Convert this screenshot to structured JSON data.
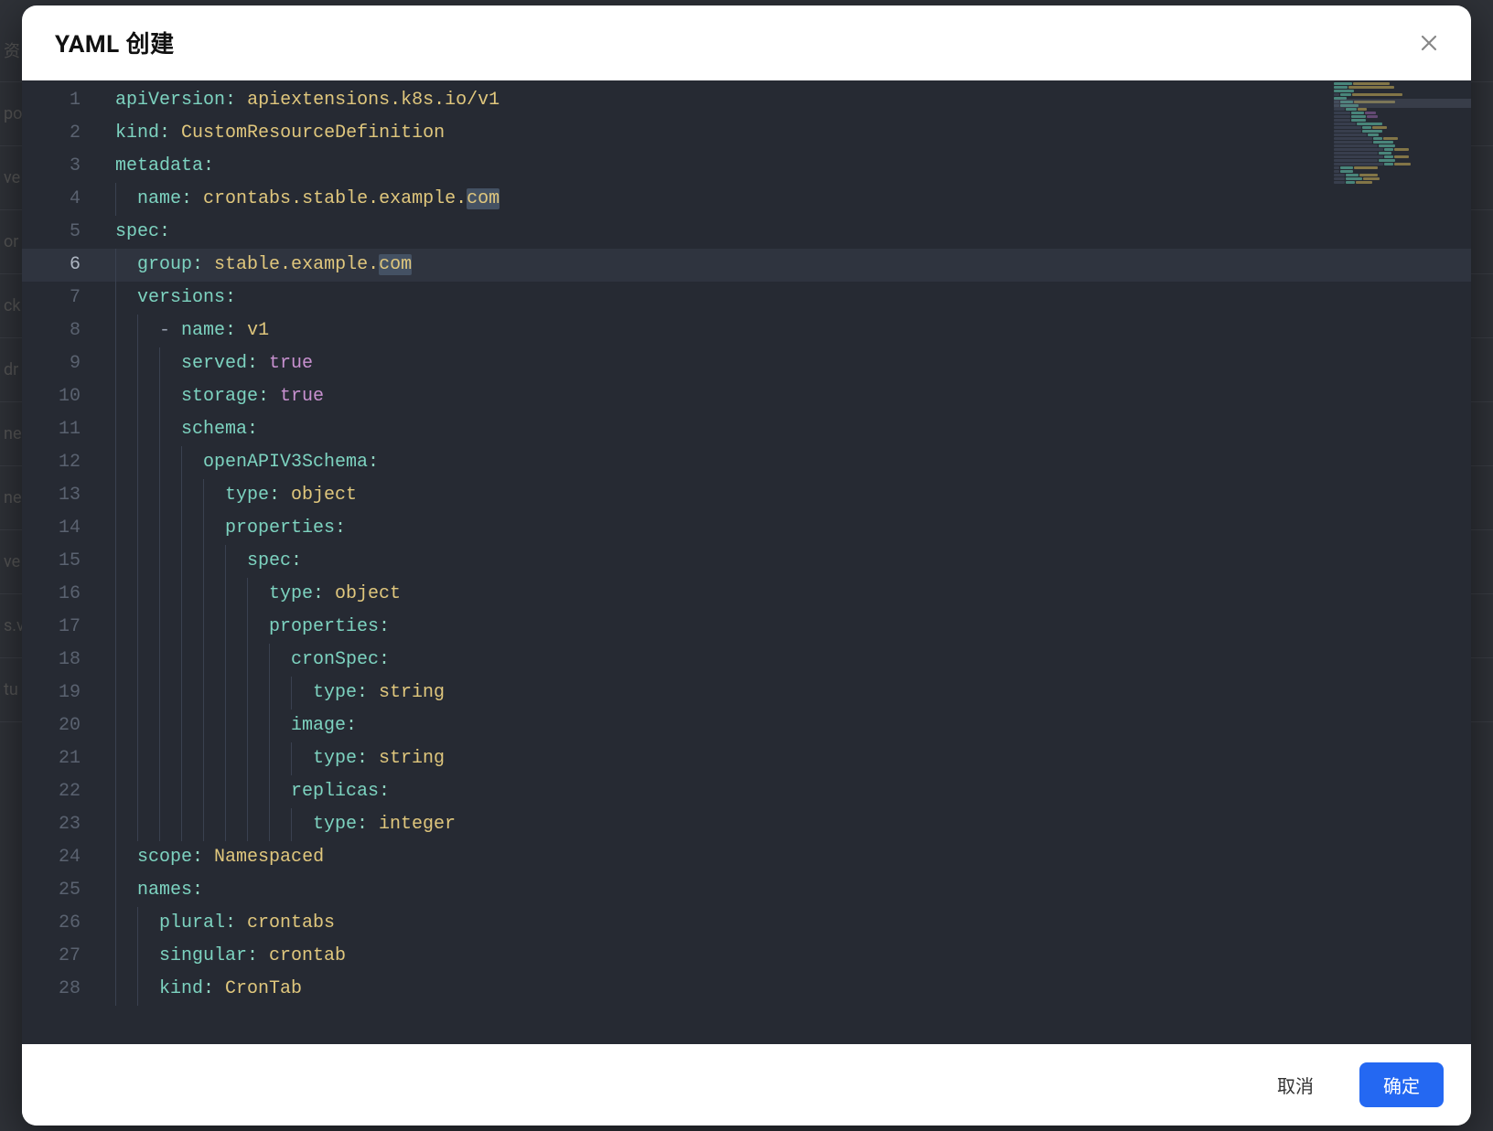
{
  "modal": {
    "title": "YAML 创建",
    "cancel_label": "取消",
    "confirm_label": "确定"
  },
  "background_items": [
    "资",
    "po",
    "ve",
    "or",
    "ck",
    "dr",
    "ne",
    "ne",
    "ve",
    "s.v",
    "tu"
  ],
  "editor": {
    "active_line": 6,
    "lines": [
      {
        "n": 1,
        "indent": 0,
        "guides": [],
        "tokens": [
          [
            "key",
            "apiVersion"
          ],
          [
            "punc",
            ":"
          ],
          [
            "plain",
            " "
          ],
          [
            "str",
            "apiextensions.k8s.io/v1"
          ]
        ]
      },
      {
        "n": 2,
        "indent": 0,
        "guides": [],
        "tokens": [
          [
            "key",
            "kind"
          ],
          [
            "punc",
            ":"
          ],
          [
            "plain",
            " "
          ],
          [
            "str",
            "CustomResourceDefinition"
          ]
        ]
      },
      {
        "n": 3,
        "indent": 0,
        "guides": [],
        "tokens": [
          [
            "key",
            "metadata"
          ],
          [
            "punc",
            ":"
          ]
        ]
      },
      {
        "n": 4,
        "indent": 1,
        "guides": [
          0
        ],
        "tokens": [
          [
            "key",
            "name"
          ],
          [
            "punc",
            ":"
          ],
          [
            "plain",
            " "
          ],
          [
            "str",
            "crontabs.stable.example."
          ],
          [
            "str-hl",
            "com"
          ]
        ]
      },
      {
        "n": 5,
        "indent": 0,
        "guides": [],
        "tokens": [
          [
            "key",
            "spec"
          ],
          [
            "punc",
            ":"
          ]
        ]
      },
      {
        "n": 6,
        "indent": 1,
        "guides": [
          0
        ],
        "tokens": [
          [
            "key",
            "group"
          ],
          [
            "punc",
            ":"
          ],
          [
            "plain",
            " "
          ],
          [
            "str",
            "stable.example."
          ],
          [
            "str-hl",
            "com"
          ]
        ]
      },
      {
        "n": 7,
        "indent": 1,
        "guides": [
          0
        ],
        "tokens": [
          [
            "key",
            "versions"
          ],
          [
            "punc",
            ":"
          ]
        ]
      },
      {
        "n": 8,
        "indent": 2,
        "guides": [
          0,
          1
        ],
        "tokens": [
          [
            "dash",
            "- "
          ],
          [
            "key",
            "name"
          ],
          [
            "punc",
            ":"
          ],
          [
            "plain",
            " "
          ],
          [
            "str",
            "v1"
          ]
        ]
      },
      {
        "n": 9,
        "indent": 3,
        "guides": [
          0,
          1,
          2
        ],
        "tokens": [
          [
            "key",
            "served"
          ],
          [
            "punc",
            ":"
          ],
          [
            "plain",
            " "
          ],
          [
            "bool",
            "true"
          ]
        ]
      },
      {
        "n": 10,
        "indent": 3,
        "guides": [
          0,
          1,
          2
        ],
        "tokens": [
          [
            "key",
            "storage"
          ],
          [
            "punc",
            ":"
          ],
          [
            "plain",
            " "
          ],
          [
            "bool",
            "true"
          ]
        ]
      },
      {
        "n": 11,
        "indent": 3,
        "guides": [
          0,
          1,
          2
        ],
        "tokens": [
          [
            "key",
            "schema"
          ],
          [
            "punc",
            ":"
          ]
        ]
      },
      {
        "n": 12,
        "indent": 4,
        "guides": [
          0,
          1,
          2,
          3
        ],
        "tokens": [
          [
            "key",
            "openAPIV3Schema"
          ],
          [
            "punc",
            ":"
          ]
        ]
      },
      {
        "n": 13,
        "indent": 5,
        "guides": [
          0,
          1,
          2,
          3,
          4
        ],
        "tokens": [
          [
            "key",
            "type"
          ],
          [
            "punc",
            ":"
          ],
          [
            "plain",
            " "
          ],
          [
            "str",
            "object"
          ]
        ]
      },
      {
        "n": 14,
        "indent": 5,
        "guides": [
          0,
          1,
          2,
          3,
          4
        ],
        "tokens": [
          [
            "key",
            "properties"
          ],
          [
            "punc",
            ":"
          ]
        ]
      },
      {
        "n": 15,
        "indent": 6,
        "guides": [
          0,
          1,
          2,
          3,
          4,
          5
        ],
        "tokens": [
          [
            "key",
            "spec"
          ],
          [
            "punc",
            ":"
          ]
        ]
      },
      {
        "n": 16,
        "indent": 7,
        "guides": [
          0,
          1,
          2,
          3,
          4,
          5,
          6
        ],
        "tokens": [
          [
            "key",
            "type"
          ],
          [
            "punc",
            ":"
          ],
          [
            "plain",
            " "
          ],
          [
            "str",
            "object"
          ]
        ]
      },
      {
        "n": 17,
        "indent": 7,
        "guides": [
          0,
          1,
          2,
          3,
          4,
          5,
          6
        ],
        "tokens": [
          [
            "key",
            "properties"
          ],
          [
            "punc",
            ":"
          ]
        ]
      },
      {
        "n": 18,
        "indent": 8,
        "guides": [
          0,
          1,
          2,
          3,
          4,
          5,
          6,
          7
        ],
        "tokens": [
          [
            "key",
            "cronSpec"
          ],
          [
            "punc",
            ":"
          ]
        ]
      },
      {
        "n": 19,
        "indent": 9,
        "guides": [
          0,
          1,
          2,
          3,
          4,
          5,
          6,
          7,
          8
        ],
        "tokens": [
          [
            "key",
            "type"
          ],
          [
            "punc",
            ":"
          ],
          [
            "plain",
            " "
          ],
          [
            "str",
            "string"
          ]
        ]
      },
      {
        "n": 20,
        "indent": 8,
        "guides": [
          0,
          1,
          2,
          3,
          4,
          5,
          6,
          7
        ],
        "tokens": [
          [
            "key",
            "image"
          ],
          [
            "punc",
            ":"
          ]
        ]
      },
      {
        "n": 21,
        "indent": 9,
        "guides": [
          0,
          1,
          2,
          3,
          4,
          5,
          6,
          7,
          8
        ],
        "tokens": [
          [
            "key",
            "type"
          ],
          [
            "punc",
            ":"
          ],
          [
            "plain",
            " "
          ],
          [
            "str",
            "string"
          ]
        ]
      },
      {
        "n": 22,
        "indent": 8,
        "guides": [
          0,
          1,
          2,
          3,
          4,
          5,
          6,
          7
        ],
        "tokens": [
          [
            "key",
            "replicas"
          ],
          [
            "punc",
            ":"
          ]
        ]
      },
      {
        "n": 23,
        "indent": 9,
        "guides": [
          0,
          1,
          2,
          3,
          4,
          5,
          6,
          7,
          8
        ],
        "tokens": [
          [
            "key",
            "type"
          ],
          [
            "punc",
            ":"
          ],
          [
            "plain",
            " "
          ],
          [
            "str",
            "integer"
          ]
        ]
      },
      {
        "n": 24,
        "indent": 1,
        "guides": [
          0
        ],
        "tokens": [
          [
            "key",
            "scope"
          ],
          [
            "punc",
            ":"
          ],
          [
            "plain",
            " "
          ],
          [
            "str",
            "Namespaced"
          ]
        ]
      },
      {
        "n": 25,
        "indent": 1,
        "guides": [
          0
        ],
        "tokens": [
          [
            "key",
            "names"
          ],
          [
            "punc",
            ":"
          ]
        ]
      },
      {
        "n": 26,
        "indent": 2,
        "guides": [
          0,
          1
        ],
        "tokens": [
          [
            "key",
            "plural"
          ],
          [
            "punc",
            ":"
          ],
          [
            "plain",
            " "
          ],
          [
            "str",
            "crontabs"
          ]
        ]
      },
      {
        "n": 27,
        "indent": 2,
        "guides": [
          0,
          1
        ],
        "tokens": [
          [
            "key",
            "singular"
          ],
          [
            "punc",
            ":"
          ],
          [
            "plain",
            " "
          ],
          [
            "str",
            "crontab"
          ]
        ]
      },
      {
        "n": 28,
        "indent": 2,
        "guides": [
          0,
          1
        ],
        "tokens": [
          [
            "key",
            "kind"
          ],
          [
            "punc",
            ":"
          ],
          [
            "plain",
            " "
          ],
          [
            "str",
            "CronTab"
          ]
        ]
      }
    ]
  }
}
